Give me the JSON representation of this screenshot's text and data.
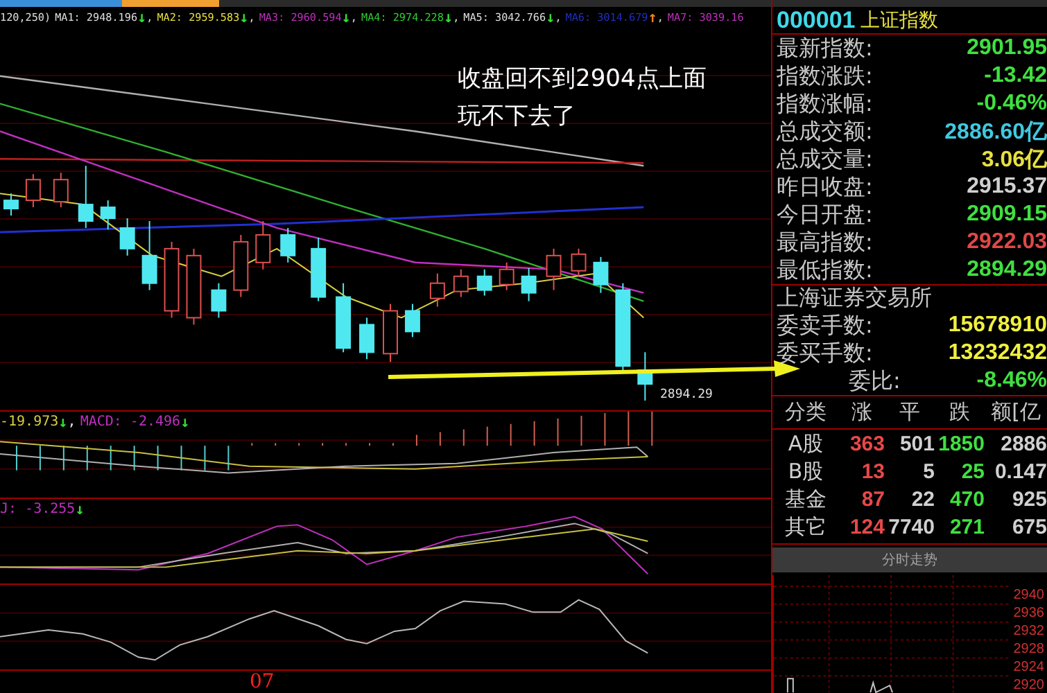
{
  "legend": [
    {
      "text": "120,250)",
      "color": "#e0e0e0"
    },
    {
      "text": "MA1: 2948.196",
      "color": "#e0e0e0",
      "arrow": {
        "text": "↓",
        "color": "#30e030"
      },
      "sep": ","
    },
    {
      "text": "MA2: 2959.583",
      "color": "#e8e040",
      "arrow": {
        "text": "↓",
        "color": "#30e030"
      },
      "sep": ","
    },
    {
      "text": "MA3: 2960.594",
      "color": "#c030c0",
      "arrow": {
        "text": "↓",
        "color": "#30e030"
      },
      "sep": ","
    },
    {
      "text": "MA4: 2974.228",
      "color": "#30d030",
      "arrow": {
        "text": "↓",
        "color": "#30e030"
      },
      "sep": ","
    },
    {
      "text": "MA5: 3042.766",
      "color": "#e0e0e0",
      "arrow": {
        "text": "↓",
        "color": "#30e030"
      },
      "sep": ","
    },
    {
      "text": "MA6: 3014.679",
      "color": "#2030c0",
      "arrow": {
        "text": "↑",
        "color": "#f08020"
      },
      "sep": ","
    },
    {
      "text": "MA7: 3039.16",
      "color": "#c030c0"
    }
  ],
  "annotation": [
    "收盘回不到2904点上面",
    "玩不下去了"
  ],
  "low_label": "2894.29",
  "macd_legend": [
    {
      "text": "-19.973",
      "color": "#d8d040",
      "arrow": {
        "text": "↓",
        "color": "#30e030"
      },
      "sep": ","
    },
    {
      "text": "MACD: -2.496",
      "color": "#c030c0",
      "arrow": {
        "text": "↓",
        "color": "#30e030"
      }
    }
  ],
  "kdj_legend": [
    {
      "text": "J: -3.255",
      "color": "#c030c0",
      "arrow": {
        "text": "↓",
        "color": "#30e030"
      }
    }
  ],
  "date_label": "07",
  "quote": {
    "code": "000001",
    "name": "上证指数",
    "stats": [
      {
        "label": "最新指数:",
        "value": "2901.95",
        "color": "#40e040"
      },
      {
        "label": "指数涨跌:",
        "value": "-13.42",
        "color": "#40e040"
      },
      {
        "label": "指数涨幅:",
        "value": "-0.46%",
        "color": "#40e040"
      },
      {
        "label": "总成交额:",
        "value": "2886.60亿",
        "color": "#40c8e0"
      },
      {
        "label": "总成交量:",
        "value": "3.06亿",
        "color": "#e8e040"
      },
      {
        "label": "昨日收盘:",
        "value": "2915.37",
        "color": "#d0d0d0"
      },
      {
        "label": "今日开盘:",
        "value": "2909.15",
        "color": "#40e040"
      },
      {
        "label": "最高指数:",
        "value": "2922.03",
        "color": "#e04848"
      },
      {
        "label": "最低指数:",
        "value": "2894.29",
        "color": "#40e040"
      }
    ],
    "exchange": "上海证券交易所",
    "orders": [
      {
        "label": "委卖手数:",
        "value": "15678910",
        "color": "#f0f040"
      },
      {
        "label": "委买手数:",
        "value": "13232432",
        "color": "#f0f040"
      },
      {
        "label": "委比:",
        "value": "-8.46%",
        "color": "#40e040"
      }
    ],
    "table": {
      "columns": [
        "分类",
        "涨",
        "平",
        "跌",
        "额[亿"
      ],
      "rows": [
        [
          "A股",
          "363",
          "501",
          "1850",
          "2886"
        ],
        [
          "B股",
          "13",
          "5",
          "25",
          "0.147"
        ],
        [
          "基金",
          "87",
          "22",
          "470",
          "925"
        ],
        [
          "其它",
          "124",
          "7740",
          "271",
          "675"
        ]
      ]
    },
    "button": "分时走势",
    "mini_chart_labels": [
      "2940",
      "2936",
      "2932",
      "2928",
      "2924",
      "2920"
    ]
  }
}
